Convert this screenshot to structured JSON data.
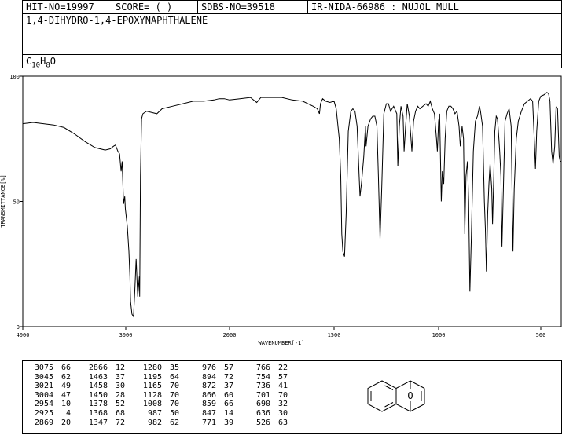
{
  "header": {
    "hit_no": "HIT-NO=19997",
    "score": "SCORE=  (   )",
    "sdbs_no": "SDBS-NO=39518",
    "ir_info": "IR-NIDA-66986 : NUJOL MULL"
  },
  "compound": {
    "name": "1,4-DIHYDRO-1,4-EPOXYNAPHTHALENE",
    "formula_prefix": "C",
    "formula_c": "10",
    "formula_h_letter": "H",
    "formula_h": "8",
    "formula_o": "O"
  },
  "structure": {
    "oxygen_label": "O"
  },
  "chart_data": {
    "type": "line",
    "xlabel": "WAVENUMBER[-1]",
    "ylabel": "TRANSMITTANCE[%]",
    "x_ticks": [
      "4000",
      "3000",
      "2000",
      "1500",
      "1000",
      "500"
    ],
    "y_ticks": [
      "100",
      "50",
      "0"
    ],
    "xlim": [
      4000,
      400
    ],
    "ylim": [
      0,
      100
    ],
    "x_scale": "piecewise linear: 4000-2000 compressed, 2000-400 expanded",
    "series": [
      {
        "points": [
          [
            4000,
            81
          ],
          [
            3900,
            81.5
          ],
          [
            3800,
            81
          ],
          [
            3700,
            80.5
          ],
          [
            3600,
            79.5
          ],
          [
            3500,
            77
          ],
          [
            3400,
            74
          ],
          [
            3300,
            71.5
          ],
          [
            3200,
            70.5
          ],
          [
            3150,
            71
          ],
          [
            3120,
            72
          ],
          [
            3100,
            72.5
          ],
          [
            3076,
            70
          ],
          [
            3060,
            69
          ],
          [
            3045,
            62
          ],
          [
            3035,
            66
          ],
          [
            3021,
            49
          ],
          [
            3010,
            52
          ],
          [
            3004,
            47
          ],
          [
            2985,
            40
          ],
          [
            2970,
            30
          ],
          [
            2960,
            20
          ],
          [
            2954,
            10
          ],
          [
            2940,
            5
          ],
          [
            2925,
            4
          ],
          [
            2912,
            15
          ],
          [
            2900,
            27
          ],
          [
            2885,
            12
          ],
          [
            2869,
            20
          ],
          [
            2866,
            12
          ],
          [
            2858,
            60
          ],
          [
            2848,
            83
          ],
          [
            2835,
            85
          ],
          [
            2800,
            86
          ],
          [
            2700,
            85
          ],
          [
            2650,
            87
          ],
          [
            2550,
            88
          ],
          [
            2450,
            89
          ],
          [
            2350,
            90
          ],
          [
            2250,
            90
          ],
          [
            2150,
            90.5
          ],
          [
            2100,
            91
          ],
          [
            2050,
            91
          ],
          [
            2000,
            90.5
          ],
          [
            1950,
            91
          ],
          [
            1900,
            91.5
          ],
          [
            1870,
            89.5
          ],
          [
            1850,
            91.5
          ],
          [
            1800,
            91.5
          ],
          [
            1750,
            91.5
          ],
          [
            1700,
            90.5
          ],
          [
            1650,
            90
          ],
          [
            1600,
            88
          ],
          [
            1580,
            87
          ],
          [
            1570,
            85
          ],
          [
            1565,
            89
          ],
          [
            1555,
            91
          ],
          [
            1540,
            90
          ],
          [
            1520,
            89.5
          ],
          [
            1500,
            90
          ],
          [
            1490,
            87
          ],
          [
            1475,
            75
          ],
          [
            1468,
            60
          ],
          [
            1463,
            37
          ],
          [
            1458,
            30
          ],
          [
            1450,
            28
          ],
          [
            1442,
            45
          ],
          [
            1432,
            78
          ],
          [
            1420,
            86
          ],
          [
            1410,
            87
          ],
          [
            1400,
            86
          ],
          [
            1390,
            80
          ],
          [
            1380,
            60
          ],
          [
            1376,
            52
          ],
          [
            1368,
            58
          ],
          [
            1358,
            68
          ],
          [
            1350,
            80
          ],
          [
            1347,
            72
          ],
          [
            1338,
            80
          ],
          [
            1325,
            83
          ],
          [
            1315,
            84
          ],
          [
            1305,
            84
          ],
          [
            1295,
            80
          ],
          [
            1288,
            60
          ],
          [
            1280,
            35
          ],
          [
            1272,
            55
          ],
          [
            1262,
            85
          ],
          [
            1250,
            89
          ],
          [
            1240,
            89
          ],
          [
            1230,
            86
          ],
          [
            1215,
            88
          ],
          [
            1200,
            85
          ],
          [
            1195,
            64
          ],
          [
            1188,
            80
          ],
          [
            1180,
            88
          ],
          [
            1170,
            84
          ],
          [
            1165,
            70
          ],
          [
            1158,
            80
          ],
          [
            1150,
            89
          ],
          [
            1140,
            84
          ],
          [
            1128,
            70
          ],
          [
            1120,
            82
          ],
          [
            1110,
            86
          ],
          [
            1100,
            88
          ],
          [
            1090,
            87
          ],
          [
            1075,
            88
          ],
          [
            1060,
            89
          ],
          [
            1050,
            88
          ],
          [
            1040,
            90
          ],
          [
            1030,
            87
          ],
          [
            1020,
            85
          ],
          [
            1010,
            75
          ],
          [
            1006,
            70
          ],
          [
            1000,
            82
          ],
          [
            995,
            85
          ],
          [
            987,
            50
          ],
          [
            982,
            62
          ],
          [
            975,
            57
          ],
          [
            968,
            75
          ],
          [
            960,
            86
          ],
          [
            950,
            88
          ],
          [
            940,
            88
          ],
          [
            930,
            87
          ],
          [
            920,
            85
          ],
          [
            910,
            86
          ],
          [
            900,
            80
          ],
          [
            894,
            72
          ],
          [
            885,
            80
          ],
          [
            878,
            75
          ],
          [
            872,
            37
          ],
          [
            866,
            60
          ],
          [
            859,
            66
          ],
          [
            853,
            50
          ],
          [
            847,
            14
          ],
          [
            840,
            35
          ],
          [
            830,
            70
          ],
          [
            820,
            82
          ],
          [
            810,
            84
          ],
          [
            800,
            88
          ],
          [
            795,
            86
          ],
          [
            785,
            80
          ],
          [
            776,
            50
          ],
          [
            771,
            39
          ],
          [
            766,
            22
          ],
          [
            760,
            45
          ],
          [
            754,
            57
          ],
          [
            748,
            65
          ],
          [
            740,
            55
          ],
          [
            736,
            41
          ],
          [
            730,
            60
          ],
          [
            725,
            78
          ],
          [
            718,
            84
          ],
          [
            712,
            83
          ],
          [
            705,
            75
          ],
          [
            701,
            70
          ],
          [
            695,
            60
          ],
          [
            690,
            32
          ],
          [
            683,
            55
          ],
          [
            675,
            82
          ],
          [
            665,
            85
          ],
          [
            655,
            87
          ],
          [
            645,
            80
          ],
          [
            636,
            30
          ],
          [
            630,
            55
          ],
          [
            620,
            75
          ],
          [
            610,
            82
          ],
          [
            595,
            86
          ],
          [
            580,
            89
          ],
          [
            565,
            90
          ],
          [
            550,
            91
          ],
          [
            540,
            90
          ],
          [
            532,
            75
          ],
          [
            526,
            63
          ],
          [
            520,
            78
          ],
          [
            510,
            90
          ],
          [
            500,
            92
          ],
          [
            485,
            92.5
          ],
          [
            470,
            93.5
          ],
          [
            462,
            93
          ],
          [
            455,
            90
          ],
          [
            447,
            70
          ],
          [
            440,
            65
          ],
          [
            432,
            72
          ],
          [
            425,
            88
          ],
          [
            418,
            87
          ],
          [
            410,
            68
          ],
          [
            405,
            66
          ],
          [
            400,
            66
          ]
        ]
      }
    ]
  },
  "peak_table": {
    "columns": [
      {
        "wn": [
          "3075",
          "3045",
          "3021",
          "3004",
          "2954",
          "2925",
          "2869"
        ],
        "t": [
          "66",
          "62",
          "49",
          "47",
          "10",
          "4",
          "20"
        ]
      },
      {
        "wn": [
          "2866",
          "1463",
          "1458",
          "1450",
          "1378",
          "1368",
          "1347"
        ],
        "t": [
          "12",
          "37",
          "30",
          "28",
          "52",
          "68",
          "72"
        ]
      },
      {
        "wn": [
          "1280",
          "1195",
          "1165",
          "1128",
          "1008",
          "987",
          "982"
        ],
        "t": [
          "35",
          "64",
          "70",
          "70",
          "70",
          "50",
          "62"
        ]
      },
      {
        "wn": [
          "976",
          "894",
          "872",
          "866",
          "859",
          "847",
          "771"
        ],
        "t": [
          "57",
          "72",
          "37",
          "60",
          "66",
          "14",
          "39"
        ]
      },
      {
        "wn": [
          "766",
          "754",
          "736",
          "701",
          "690",
          "636",
          "526"
        ],
        "t": [
          "22",
          "57",
          "41",
          "70",
          "32",
          "30",
          "63"
        ]
      }
    ]
  }
}
